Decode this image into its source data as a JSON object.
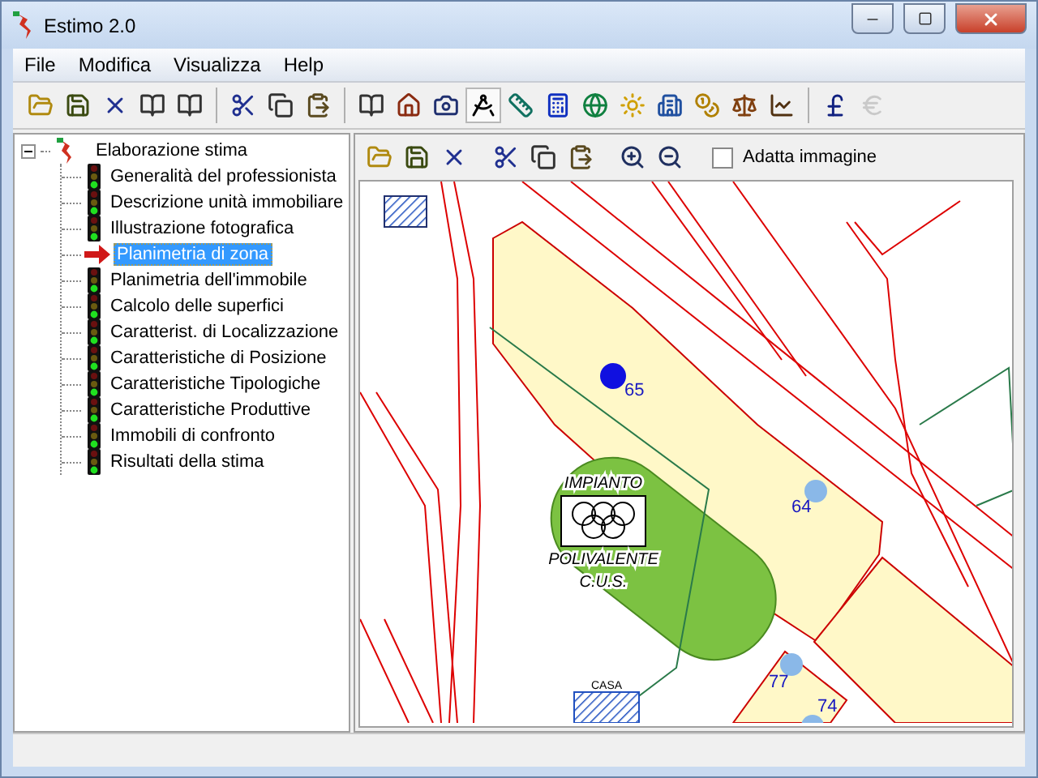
{
  "window": {
    "title": "Estimo 2.0"
  },
  "menu": [
    "File",
    "Modifica",
    "Visualizza",
    "Help"
  ],
  "main_toolbar": [
    [
      {
        "kind": "open",
        "disabled": false
      },
      {
        "kind": "save",
        "disabled": false
      },
      {
        "kind": "delete",
        "disabled": false
      },
      {
        "kind": "book",
        "disabled": false
      },
      {
        "kind": "book",
        "disabled": false
      }
    ],
    [
      {
        "kind": "cut",
        "disabled": false
      },
      {
        "kind": "copy",
        "disabled": false
      },
      {
        "kind": "paste",
        "disabled": false
      }
    ],
    [
      {
        "kind": "book",
        "disabled": false
      },
      {
        "kind": "house",
        "disabled": false
      },
      {
        "kind": "camera",
        "disabled": false
      },
      {
        "kind": "compass",
        "disabled": false
      },
      {
        "kind": "ruler",
        "disabled": false
      },
      {
        "kind": "calculator",
        "disabled": false
      },
      {
        "kind": "globe",
        "disabled": false
      },
      {
        "kind": "sun",
        "disabled": false
      },
      {
        "kind": "building",
        "disabled": false
      },
      {
        "kind": "coins",
        "disabled": false
      },
      {
        "kind": "scale",
        "disabled": false
      },
      {
        "kind": "chart",
        "disabled": false
      }
    ],
    [
      {
        "kind": "pound",
        "disabled": false
      },
      {
        "kind": "euro",
        "disabled": true
      }
    ]
  ],
  "tree": {
    "label": "Elaborazione stima",
    "expanded": true,
    "children": [
      {
        "label": "Generalità del professionista",
        "selected": false
      },
      {
        "label": "Descrizione unità immobiliare",
        "selected": false
      },
      {
        "label": "Illustrazione fotografica",
        "selected": false
      },
      {
        "label": "Planimetria di zona",
        "selected": true
      },
      {
        "label": "Planimetria dell'immobile",
        "selected": false
      },
      {
        "label": "Calcolo delle superfici",
        "selected": false
      },
      {
        "label": "Caratterist. di Localizzazione",
        "selected": false
      },
      {
        "label": "Caratteristiche di Posizione",
        "selected": false
      },
      {
        "label": "Caratteristiche Tipologiche",
        "selected": false
      },
      {
        "label": "Caratteristiche Produttive",
        "selected": false
      },
      {
        "label": "Immobili di confronto",
        "selected": false
      },
      {
        "label": "Risultati della stima",
        "selected": false
      }
    ]
  },
  "map_toolbar": {
    "tools": [
      {
        "kind": "open"
      },
      {
        "kind": "save"
      },
      {
        "kind": "delete"
      },
      {
        "kind": "cut"
      },
      {
        "kind": "copy"
      },
      {
        "kind": "paste"
      },
      {
        "kind": "zoom-in"
      },
      {
        "kind": "zoom-out"
      }
    ],
    "fit_image": {
      "label": "Adatta immagine",
      "checked": false
    }
  },
  "map": {
    "facility": [
      "IMPIANTO",
      "POLIVALENTE",
      "C.U.S."
    ],
    "building_label": "CASA",
    "markers": [
      {
        "label": "65",
        "selected": true
      },
      {
        "label": "64",
        "selected": false
      },
      {
        "label": "77",
        "selected": false
      },
      {
        "label": "74",
        "selected": false
      }
    ]
  }
}
